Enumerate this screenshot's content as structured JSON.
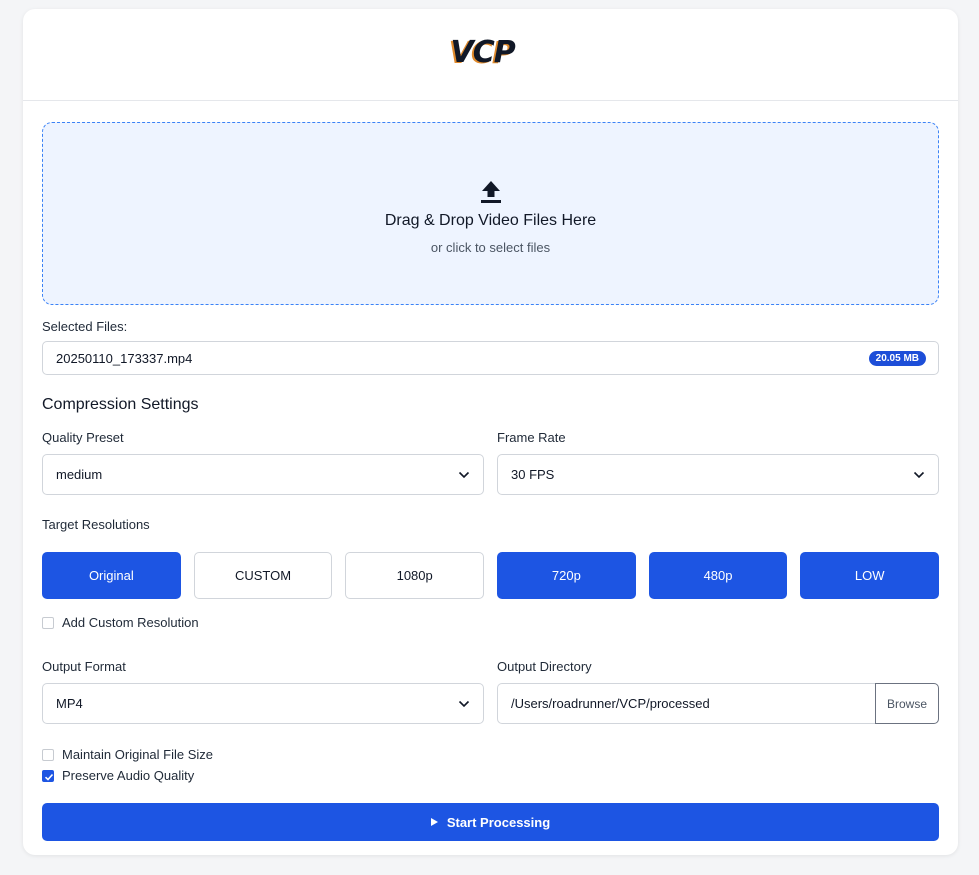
{
  "header": {
    "logo_text": "VCP"
  },
  "dropzone": {
    "title": "Drag & Drop Video Files Here",
    "subtitle": "or click to select files",
    "icon": "upload-icon"
  },
  "selected_files": {
    "label": "Selected Files:",
    "files": [
      {
        "name": "20250110_173337.mp4",
        "size": "20.05 MB"
      }
    ]
  },
  "compression": {
    "title": "Compression Settings",
    "quality_label": "Quality Preset",
    "quality_value": "medium",
    "framerate_label": "Frame Rate",
    "framerate_value": "30 FPS",
    "resolutions_label": "Target Resolutions",
    "resolutions": [
      {
        "label": "Original",
        "active": true
      },
      {
        "label": "CUSTOM",
        "active": false
      },
      {
        "label": "1080p",
        "active": false
      },
      {
        "label": "720p",
        "active": true
      },
      {
        "label": "480p",
        "active": true
      },
      {
        "label": "LOW",
        "active": true
      }
    ],
    "custom_resolution_label": "Add Custom Resolution",
    "custom_resolution_checked": false
  },
  "output": {
    "format_label": "Output Format",
    "format_value": "MP4",
    "directory_label": "Output Directory",
    "directory_value": "/Users/roadrunner/VCP/processed",
    "browse_label": "Browse"
  },
  "options": {
    "maintain_size_label": "Maintain Original File Size",
    "maintain_size_checked": false,
    "preserve_audio_label": "Preserve Audio Quality",
    "preserve_audio_checked": true
  },
  "actions": {
    "start_label": "Start Processing"
  },
  "colors": {
    "accent": "#1d55e3",
    "badge": "#1d4ed8",
    "dropzone_bg": "#eef4ff",
    "logo_shadow": "#e08a2c"
  }
}
